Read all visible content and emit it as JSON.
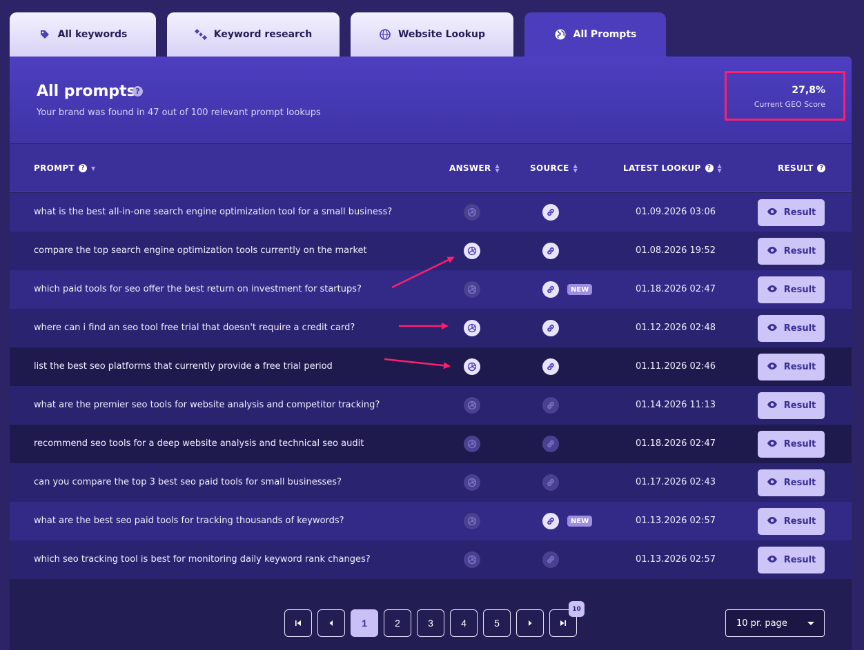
{
  "tabs": [
    {
      "label": "All keywords",
      "icon": "tag-icon"
    },
    {
      "label": "Keyword research",
      "icon": "satellite-icon"
    },
    {
      "label": "Website Lookup",
      "icon": "globe-search-icon"
    },
    {
      "label": "All Prompts",
      "icon": "globe-icon"
    }
  ],
  "header": {
    "title": "All prompts",
    "subtitle": "Your brand was found in 47 out of 100 relevant prompt lookups",
    "geo_score_value": "27,8%",
    "geo_score_label": "Current GEO Score"
  },
  "columns": {
    "prompt": "PROMPT",
    "answer": "ANSWER",
    "source": "SOURCE",
    "latest_lookup": "LATEST LOOKUP",
    "result": "RESULT"
  },
  "help_glyph": "?",
  "result_label": "Result",
  "new_label": "NEW",
  "rows": [
    {
      "prompt": "what is the best all-in-one search engine optimization tool for a small business?",
      "date": "01.09.2026 03:06",
      "answer": false,
      "source": true,
      "is_new": false
    },
    {
      "prompt": "compare the top search engine optimization tools currently on the market",
      "date": "01.08.2026 19:52",
      "answer": true,
      "source": true,
      "is_new": false
    },
    {
      "prompt": "which paid tools for seo offer the best return on investment for startups?",
      "date": "01.18.2026 02:47",
      "answer": false,
      "source": true,
      "is_new": true
    },
    {
      "prompt": "where can i find an seo tool free trial that doesn't require a credit card?",
      "date": "01.12.2026 02:48",
      "answer": true,
      "source": true,
      "is_new": false
    },
    {
      "prompt": "list the best seo platforms that currently provide a free trial period",
      "date": "01.11.2026 02:46",
      "answer": true,
      "source": true,
      "is_new": false
    },
    {
      "prompt": "what are the premier seo tools for website analysis and competitor tracking?",
      "date": "01.14.2026 11:13",
      "answer": false,
      "source": false,
      "is_new": false
    },
    {
      "prompt": "recommend seo tools for a deep website analysis and technical seo audit",
      "date": "01.18.2026 02:47",
      "answer": false,
      "source": false,
      "is_new": false
    },
    {
      "prompt": "can you compare the top 3 best seo paid tools for small businesses?",
      "date": "01.17.2026 02:43",
      "answer": false,
      "source": false,
      "is_new": false
    },
    {
      "prompt": "what are the best seo paid tools for tracking thousands of keywords?",
      "date": "01.13.2026 02:57",
      "answer": false,
      "source": true,
      "is_new": true
    },
    {
      "prompt": "which seo tracking tool is best for monitoring daily keyword rank changes?",
      "date": "01.13.2026 02:57",
      "answer": false,
      "source": false,
      "is_new": false
    }
  ],
  "pagination": {
    "pages": [
      "1",
      "2",
      "3",
      "4",
      "5"
    ],
    "current": "1",
    "total_pages_badge": "10",
    "per_page": "10 pr. page"
  },
  "colors": {
    "accent": "#4b3dbb",
    "highlight_border": "#ff1e6d",
    "arrow": "#ff1e6d",
    "button_bg": "#cdc4f7"
  }
}
